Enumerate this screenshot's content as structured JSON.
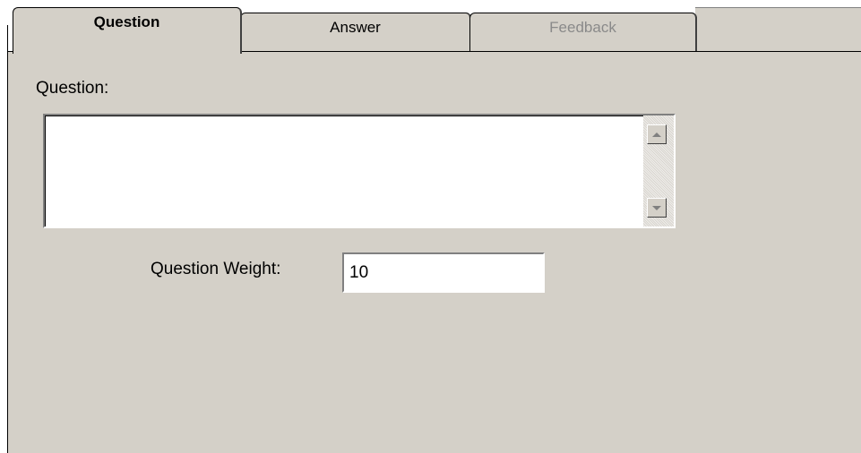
{
  "tabs": [
    {
      "label": "Question",
      "state": "active"
    },
    {
      "label": "Answer",
      "state": "normal"
    },
    {
      "label": "Feedback",
      "state": "disabled"
    }
  ],
  "question_section": {
    "label": "Question:",
    "text_value": ""
  },
  "weight": {
    "label": "Question Weight:",
    "value": "10"
  },
  "colors": {
    "panel_bg": "#d4d0c8",
    "disabled_text": "#8a8a8a"
  }
}
